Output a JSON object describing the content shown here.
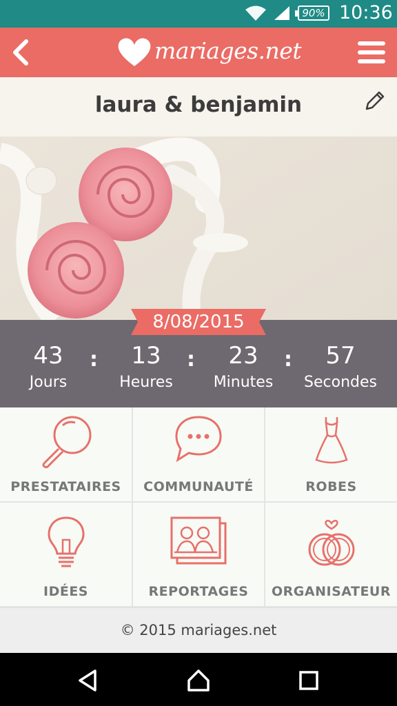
{
  "status_bar": {
    "battery": "90%",
    "time": "10:36",
    "icons": [
      "wifi-icon",
      "signal-icon",
      "battery-icon"
    ]
  },
  "app_bar": {
    "logo_text": "mariages.net",
    "back_icon": "chevron-left-icon",
    "menu_icon": "hamburger-menu-icon"
  },
  "hero": {
    "couple_name": "laura & benjamin",
    "edit_icon": "pencil-icon",
    "wedding_date": "8/08/2015"
  },
  "countdown": {
    "days": {
      "value": "43",
      "label": "Jours"
    },
    "hours": {
      "value": "13",
      "label": "Heures"
    },
    "minutes": {
      "value": "23",
      "label": "Minutes"
    },
    "seconds": {
      "value": "57",
      "label": "Secondes"
    },
    "separator": ":"
  },
  "menu": {
    "items": [
      {
        "label": "PRESTATAIRES",
        "icon": "magnifier-icon"
      },
      {
        "label": "COMMUNAUTÉ",
        "icon": "chat-bubble-icon"
      },
      {
        "label": "ROBES",
        "icon": "dress-icon"
      },
      {
        "label": "IDÉES",
        "icon": "lightbulb-icon"
      },
      {
        "label": "REPORTAGES",
        "icon": "photos-icon"
      },
      {
        "label": "ORGANISATEUR",
        "icon": "rings-icon"
      }
    ]
  },
  "footer": {
    "copyright": "© 2015 mariages.net"
  },
  "colors": {
    "status_bar": "#1f8a86",
    "brand": "#ea6c65",
    "countdown_bg": "#6e6870",
    "icon_stroke": "#e8706a",
    "label_gray": "#777777"
  }
}
